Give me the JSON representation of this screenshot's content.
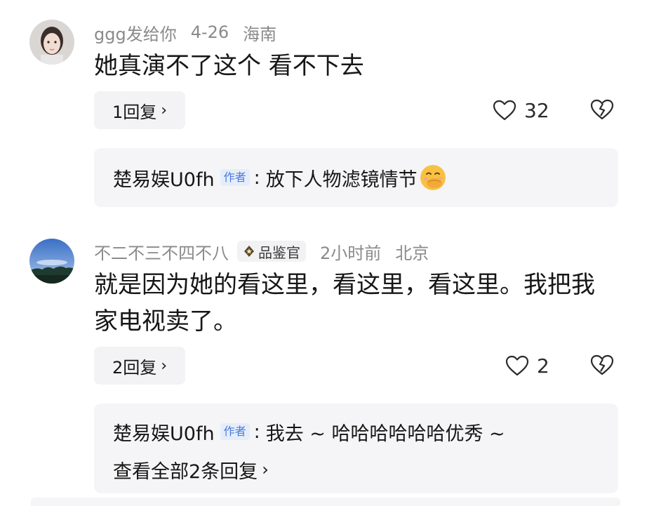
{
  "comments": [
    {
      "username": "ggg发给你",
      "date": "4-26",
      "location": "海南",
      "text": "她真演不了这个 看不下去",
      "reply_button": "1回复",
      "likes": "32",
      "reply_preview": {
        "author": "楚易娱U0fh",
        "author_tag": "作者",
        "separator": ":",
        "text": "放下人物滤镜情节"
      }
    },
    {
      "username": "不二不三不四不八",
      "badge": "品鉴官",
      "date": "2小时前",
      "location": "北京",
      "text": "就是因为她的看这里，看这里，看这里。我把我家电视卖了。",
      "reply_button": "2回复",
      "likes": "2",
      "reply_preview": {
        "author": "楚易娱U0fh",
        "author_tag": "作者",
        "separator": ":",
        "text": "我去 ~ 哈哈哈哈哈哈优秀 ~"
      },
      "view_all": "查看全部2条回复"
    }
  ],
  "icons": {
    "chevron": "›",
    "heart": "heart-outline-icon",
    "dislike": "broken-heart-icon",
    "emoji": "hand-over-mouth-emoji-icon"
  },
  "colors": {
    "meta_gray": "#8a8a8a",
    "card_bg": "#f5f5f7",
    "author_tag_blue": "#4a7ad8",
    "emoji_yellow": "#f7c243"
  }
}
